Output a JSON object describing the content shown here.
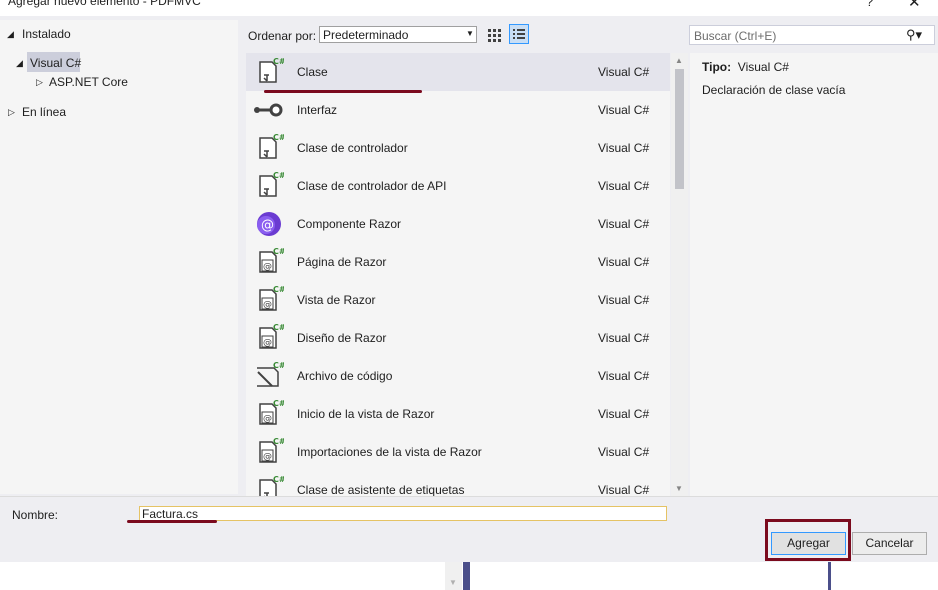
{
  "window": {
    "title": "Agregar nuevo elemento - PDFMVC",
    "help_glyph": "?",
    "close_glyph": "✕"
  },
  "tree": {
    "installed": "Instalado",
    "visual_csharp": "Visual C#",
    "aspnet_core": "ASP.NET Core",
    "online": "En línea"
  },
  "toolbar": {
    "sort_label": "Ordenar por:",
    "sort_value": "Predeterminado",
    "search_placeholder": "Buscar (Ctrl+E)"
  },
  "items": [
    {
      "name": "Clase",
      "lang": "Visual C#",
      "icon": "class-icon"
    },
    {
      "name": "Interfaz",
      "lang": "Visual C#",
      "icon": "interface-icon"
    },
    {
      "name": "Clase de controlador",
      "lang": "Visual C#",
      "icon": "controller-class-icon"
    },
    {
      "name": "Clase de controlador de API",
      "lang": "Visual C#",
      "icon": "api-controller-class-icon"
    },
    {
      "name": "Componente Razor",
      "lang": "Visual C#",
      "icon": "razor-component-icon"
    },
    {
      "name": "Página de Razor",
      "lang": "Visual C#",
      "icon": "razor-page-icon"
    },
    {
      "name": "Vista de Razor",
      "lang": "Visual C#",
      "icon": "razor-view-icon"
    },
    {
      "name": "Diseño de Razor",
      "lang": "Visual C#",
      "icon": "razor-layout-icon"
    },
    {
      "name": "Archivo de código",
      "lang": "Visual C#",
      "icon": "code-file-icon"
    },
    {
      "name": "Inicio de la vista de Razor",
      "lang": "Visual C#",
      "icon": "razor-viewstart-icon"
    },
    {
      "name": "Importaciones de la vista de Razor",
      "lang": "Visual C#",
      "icon": "razor-viewimports-icon"
    },
    {
      "name": "Clase de asistente de etiquetas",
      "lang": "Visual C#",
      "icon": "tag-helper-class-icon"
    }
  ],
  "details": {
    "type_label": "Tipo:",
    "type_value": "Visual C#",
    "description": "Declaración de clase vacía"
  },
  "bottom": {
    "name_label": "Nombre:",
    "name_value": "Factura.cs",
    "add_button": "Agregar",
    "cancel_button": "Cancelar"
  },
  "colors": {
    "accent": "#3399ff",
    "annotation": "#7b0a1e",
    "razor_purple": "#6a3bd1"
  }
}
